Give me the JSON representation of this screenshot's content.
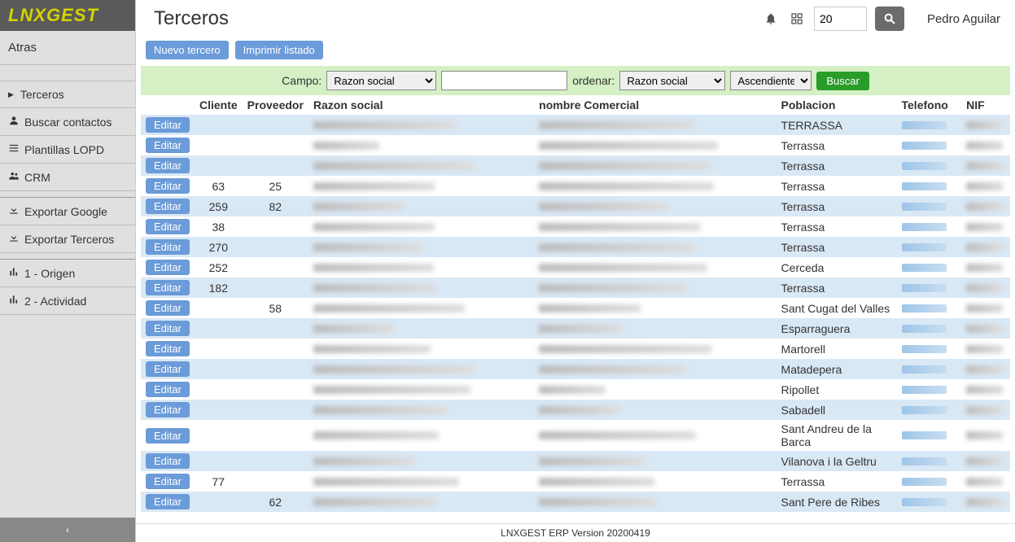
{
  "brand": "LNXGEST",
  "page_title": "Terceros",
  "topbar": {
    "number_value": "20",
    "user_name": "Pedro Aguilar"
  },
  "sidebar": {
    "back_label": "Atras",
    "items": [
      {
        "label": "Terceros",
        "icon": "",
        "active": true
      },
      {
        "label": "Buscar contactos",
        "icon": "user"
      },
      {
        "label": "Plantillas LOPD",
        "icon": "list"
      },
      {
        "label": "CRM",
        "icon": "users"
      }
    ],
    "items2": [
      {
        "label": "Exportar Google",
        "icon": "download"
      },
      {
        "label": "Exportar Terceros",
        "icon": "download"
      }
    ],
    "items3": [
      {
        "label": "1 - Origen",
        "icon": "chart"
      },
      {
        "label": "2 - Actividad",
        "icon": "chart"
      }
    ]
  },
  "actions": {
    "nuevo": "Nuevo tercero",
    "imprimir": "Imprimir listado"
  },
  "filter": {
    "campo_label": "Campo:",
    "campo_value": "Razon social",
    "ordenar_label": "ordenar:",
    "ordenar_value": "Razon social",
    "dir_value": "Ascendiente",
    "buscar_label": "Buscar"
  },
  "table": {
    "edit_label": "Editar",
    "headers": {
      "cliente": "Cliente",
      "proveedor": "Proveedor",
      "razon": "Razon social",
      "nombre": "nombre Comercial",
      "poblacion": "Poblacion",
      "telefono": "Telefono",
      "nif": "NIF"
    },
    "rows": [
      {
        "cliente": "",
        "proveedor": "",
        "poblacion": "TERRASSA"
      },
      {
        "cliente": "",
        "proveedor": "",
        "poblacion": "Terrassa"
      },
      {
        "cliente": "",
        "proveedor": "",
        "poblacion": "Terrassa"
      },
      {
        "cliente": "63",
        "proveedor": "25",
        "poblacion": "Terrassa"
      },
      {
        "cliente": "259",
        "proveedor": "82",
        "poblacion": "Terrassa"
      },
      {
        "cliente": "38",
        "proveedor": "",
        "poblacion": "Terrassa"
      },
      {
        "cliente": "270",
        "proveedor": "",
        "poblacion": "Terrassa"
      },
      {
        "cliente": "252",
        "proveedor": "",
        "poblacion": "Cerceda"
      },
      {
        "cliente": "182",
        "proveedor": "",
        "poblacion": "Terrassa"
      },
      {
        "cliente": "",
        "proveedor": "58",
        "poblacion": "Sant Cugat del Valles"
      },
      {
        "cliente": "",
        "proveedor": "",
        "poblacion": "Esparraguera"
      },
      {
        "cliente": "",
        "proveedor": "",
        "poblacion": "Martorell"
      },
      {
        "cliente": "",
        "proveedor": "",
        "poblacion": "Matadepera"
      },
      {
        "cliente": "",
        "proveedor": "",
        "poblacion": "Ripollet"
      },
      {
        "cliente": "",
        "proveedor": "",
        "poblacion": "Sabadell"
      },
      {
        "cliente": "",
        "proveedor": "",
        "poblacion": "Sant Andreu de la Barca"
      },
      {
        "cliente": "",
        "proveedor": "",
        "poblacion": "Vilanova i la Geltru"
      },
      {
        "cliente": "77",
        "proveedor": "",
        "poblacion": "Terrassa"
      },
      {
        "cliente": "",
        "proveedor": "62",
        "poblacion": "Sant Pere de Ribes"
      }
    ]
  },
  "footer": "LNXGEST ERP Version 20200419"
}
